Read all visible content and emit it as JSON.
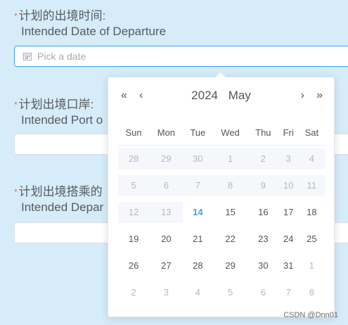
{
  "form": {
    "departure_date": {
      "required_mark": "*",
      "label_cn": "计划的出境时间:",
      "label_en": "Intended Date of Departure",
      "placeholder": "Pick a date",
      "icon": "calendar-icon"
    },
    "departure_port": {
      "required_mark": "*",
      "label_cn": "计划出境口岸:",
      "label_en": "Intended Port o",
      "value": ""
    },
    "departure_transport": {
      "required_mark": "*",
      "label_cn": "计划出境搭乘的",
      "label_en": "Intended Depar",
      "value": ""
    }
  },
  "datepicker": {
    "year": "2024",
    "month": "May",
    "nav": {
      "prev_year": "«",
      "prev_month": "‹",
      "next_month": "›",
      "next_year": "»"
    },
    "weekdays": [
      "Sun",
      "Mon",
      "Tue",
      "Wed",
      "Thu",
      "Fri",
      "Sat"
    ],
    "weeks": [
      [
        "28",
        "29",
        "30",
        "1",
        "2",
        "3",
        "4"
      ],
      [
        "5",
        "6",
        "7",
        "8",
        "9",
        "10",
        "11"
      ],
      [
        "12",
        "13",
        "14",
        "15",
        "16",
        "17",
        "18"
      ],
      [
        "19",
        "20",
        "21",
        "22",
        "23",
        "24",
        "25"
      ],
      [
        "26",
        "27",
        "28",
        "29",
        "30",
        "31",
        "1"
      ],
      [
        "2",
        "3",
        "4",
        "5",
        "6",
        "7",
        "8"
      ]
    ],
    "today": "14",
    "accent_color": "#409eff"
  },
  "watermark": "CSDN @Dnn01"
}
